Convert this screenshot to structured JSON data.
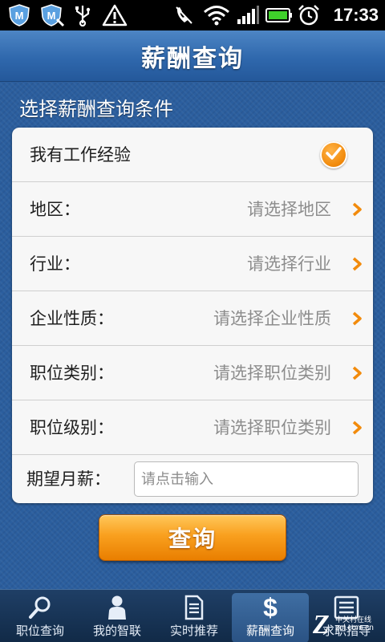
{
  "status_bar": {
    "time": "17:33",
    "icons": [
      "mcafee-shield-icon",
      "mcafee-shield-update-icon",
      "usb-icon",
      "warning-icon",
      "call-muted-icon",
      "wifi-icon",
      "signal-icon",
      "battery-icon",
      "alarm-icon"
    ]
  },
  "header": {
    "title": "薪酬查询"
  },
  "form": {
    "heading": "选择薪酬查询条件",
    "experience": {
      "label": "我有工作经验",
      "checked": true
    },
    "region": {
      "label": "地区：",
      "value": "请选择地区"
    },
    "industry": {
      "label": "行业：",
      "value": "请选择行业"
    },
    "company_type": {
      "label": "企业性质：",
      "value": "请选择企业性质"
    },
    "job_category": {
      "label": "职位类别：",
      "value": "请选择职位类别"
    },
    "job_level": {
      "label": "职位级别：",
      "value": "请选择职位类别"
    },
    "salary": {
      "label": "期望月薪：",
      "placeholder": "请点击输入",
      "value": ""
    },
    "submit_label": "查询"
  },
  "bottom_nav": {
    "tabs": [
      {
        "label": "职位查询",
        "icon": "search-icon"
      },
      {
        "label": "我的智联",
        "icon": "person-icon"
      },
      {
        "label": "实时推荐",
        "icon": "document-icon"
      },
      {
        "label": "薪酬查询",
        "icon": "dollar-icon",
        "active": true
      },
      {
        "label": "求职指导",
        "icon": "list-icon"
      }
    ]
  },
  "watermark": {
    "line1": "中关村在线",
    "line2": "zol.com.cn"
  },
  "colors": {
    "accent": "#f28b0c",
    "header": "#2f68ad",
    "background": "#2b5e9e"
  }
}
